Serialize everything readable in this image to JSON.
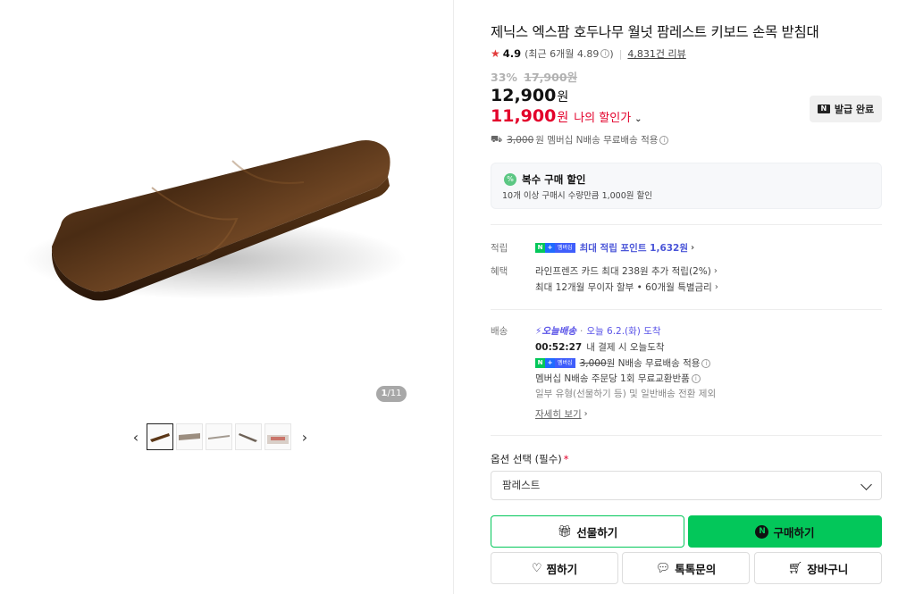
{
  "gallery": {
    "counter_current": "1",
    "counter_total": "/11",
    "prev_icon": "chevron-left-icon",
    "next_icon": "chevron-right-icon",
    "thumbnail_count": 5
  },
  "product": {
    "title": "제닉스 엑스팜 호두나무 월넛 팜레스트 키보드 손목 받침대",
    "rating": "4.9",
    "rating_recent": "(최근 6개월 4.89",
    "rating_recent_close": ")",
    "review_count": "4,831건 리뷰",
    "discount_rate": "33%",
    "original_price": "17,900원",
    "price": "12,900",
    "price_unit": "원",
    "my_price": "11,900",
    "my_price_unit": "원",
    "my_price_label": "나의 할인가",
    "coupon_button": "발급 완료",
    "coupon_logo": "N",
    "shipping_fee_strike": "3,000",
    "shipping_text_pre": "원 멤버십 N배송 무료배송 적용"
  },
  "bulk": {
    "icon": "%",
    "title": "복수 구매 할인",
    "desc": "10개 이상 구매시 수량만큼 1,000원 할인"
  },
  "benefits": {
    "points_label": "적립",
    "points_text": "최대 적립 포인트 1,632원",
    "perks_label": "혜택",
    "perk1": "라인프렌즈 카드 최대 238원 추가 적립(2%)",
    "perk2": "최대 12개월 무이자 할부 • 60개월 특별금리"
  },
  "delivery": {
    "label": "배송",
    "today_badge": "오늘배송",
    "today_arrival": "오늘 6.2.(화) 도착",
    "countdown": "00:52:27",
    "countdown_text": "내 결제 시 오늘도착",
    "fee_strike": "3,000",
    "fee_text": "원 N배송 무료배송 적용",
    "exchange": "멤버십 N배송 주문당 1회 무료교환반품",
    "exclusion": "일부 유형(선물하기 등) 및 일반배송 전환 제외",
    "more_link": "자세히 보기"
  },
  "options": {
    "label": "옵션 선택 (필수)",
    "required_mark": "*",
    "selected": "팜레스트"
  },
  "actions": {
    "gift": "선물하기",
    "buy": "구매하기",
    "wish": "찜하기",
    "talk": "톡톡문의",
    "cart": "장바구니"
  },
  "badges": {
    "npay_n": "N",
    "npay_plus": "+",
    "membership": "멤버십"
  },
  "colors": {
    "brand_green": "#03c75a",
    "price_red": "#e3002b",
    "point_blue": "#4a55d8"
  }
}
